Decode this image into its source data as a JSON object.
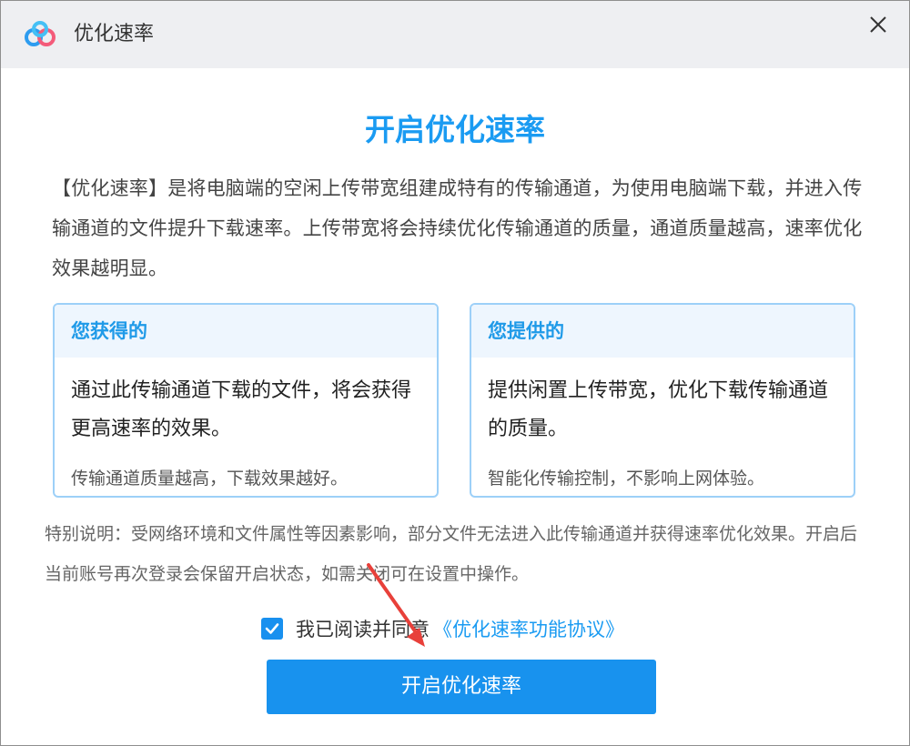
{
  "window": {
    "title": "优化速率",
    "logo_icon": "baidu-netdisk-cloud-icon",
    "close_icon": "close-icon"
  },
  "headline": "开启优化速率",
  "description": "【优化速率】是将电脑端的空闲上传带宽组建成特有的传输通道，为使用电脑端下载，并进入传输通道的文件提升下载速率。上传带宽将会持续优化传输通道的质量，通道质量越高，速率优化效果越明显。",
  "cards": {
    "gain": {
      "title": "您获得的",
      "main": "通过此传输通道下载的文件，将会获得更高速率的效果。",
      "sub": "传输通道质量越高，下载效果越好。"
    },
    "provide": {
      "title": "您提供的",
      "main": "提供闲置上传带宽，优化下载传输通道的质量。",
      "sub": "智能化传输控制，不影响上网体验。"
    }
  },
  "note": "特别说明：受网络环境和文件属性等因素影响，部分文件无法进入此传输通道并获得速率优化效果。开启后当前账号再次登录会保留开启状态，如需关闭可在设置中操作。",
  "agreement": {
    "checked": true,
    "text": "我已阅读并同意",
    "link": "《优化速率功能协议》"
  },
  "primary_button": "开启优化速率",
  "colors": {
    "accent": "#1a9bf2",
    "button": "#1892ee",
    "annotation_arrow": "#e8403a"
  }
}
